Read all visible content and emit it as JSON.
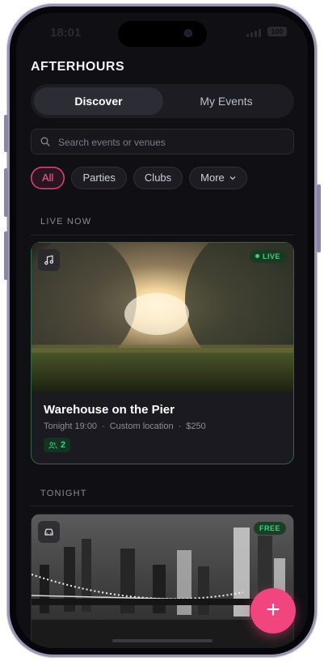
{
  "status_bar": {
    "time": "18:01",
    "battery": "100"
  },
  "app": {
    "title": "AFTERHOURS"
  },
  "tabs": [
    {
      "label": "Discover"
    },
    {
      "label": "My Events"
    }
  ],
  "search": {
    "placeholder": "Search events or venues",
    "value": ""
  },
  "filters": [
    {
      "label": "All",
      "active": true
    },
    {
      "label": "Parties"
    },
    {
      "label": "Clubs"
    },
    {
      "label": "More"
    }
  ],
  "sections": {
    "live_now": "LIVE NOW",
    "tonight": "TONIGHT"
  },
  "live_event": {
    "category_icon": "music-note-icon",
    "tag": "LIVE",
    "title": "Warehouse on the Pier",
    "time": "Tonight 19:00",
    "location": "Custom location",
    "price": "$250",
    "attendees": "2"
  },
  "tonight_event": {
    "category_icon": "car-icon",
    "tag": "FREE"
  },
  "fab": {
    "label": "+"
  },
  "colors": {
    "accent": "#f0457e",
    "live_green": "#3ccf7a",
    "background": "#0f0f14"
  }
}
